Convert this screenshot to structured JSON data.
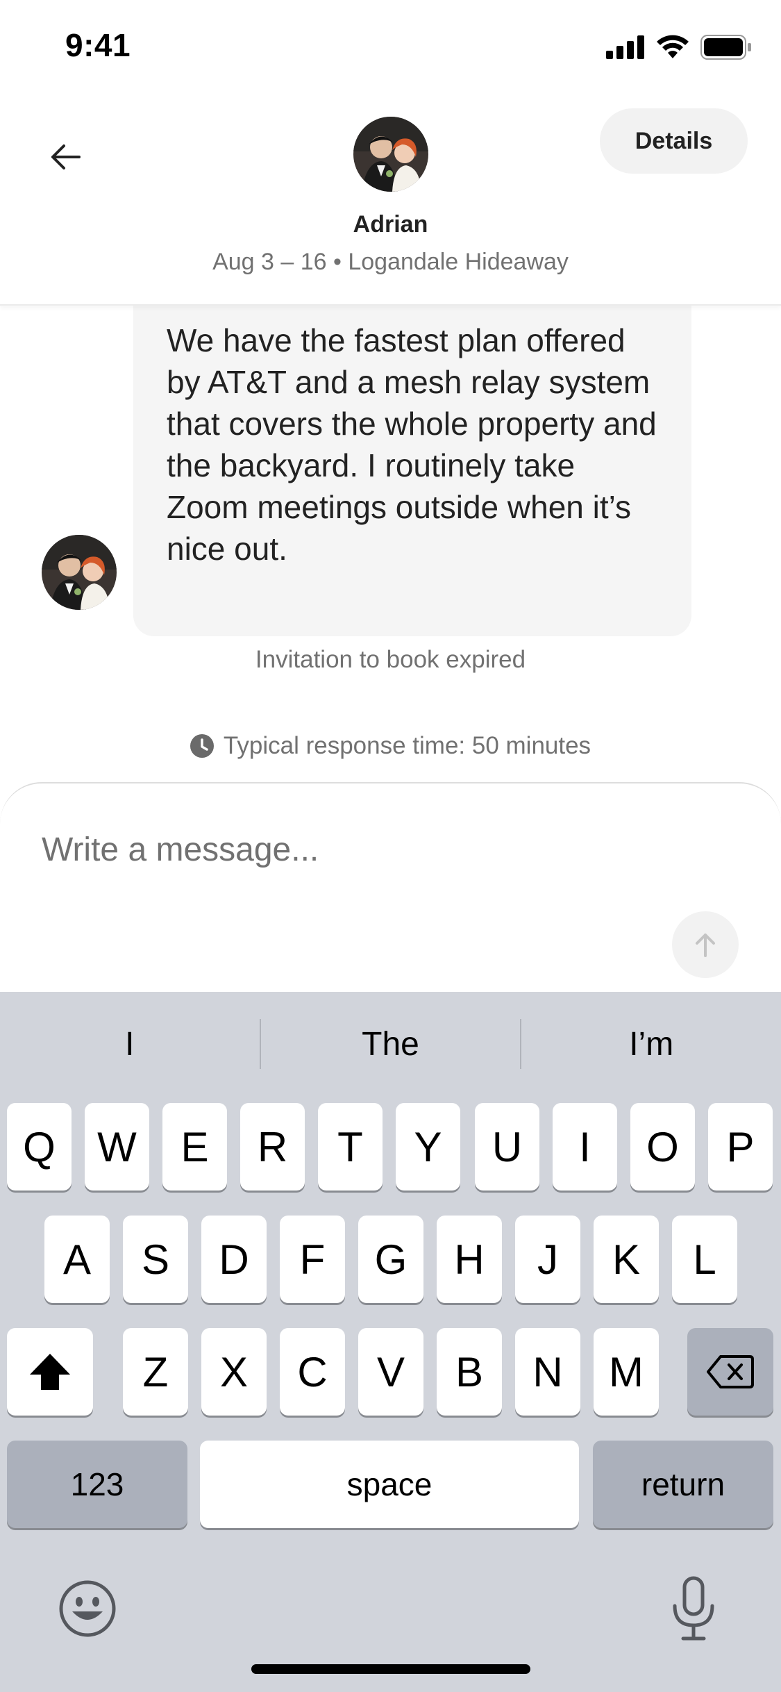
{
  "status_bar": {
    "time": "9:41",
    "icons": [
      "cellular-signal-icon",
      "wifi-icon",
      "battery-icon"
    ]
  },
  "header": {
    "back_icon": "arrow-left-icon",
    "host_name": "Adrian",
    "trip_info": "Aug 3 – 16 • Logandale Hideaway",
    "details_label": "Details"
  },
  "conversation": {
    "message_text": "We have the fastest plan offered by AT&T and a mesh relay system that covers the whole property and the backyard. I routinely take Zoom meetings outside when it’s nice out.",
    "system_note": "Invitation to book expired",
    "response_time": "Typical response time: 50 minutes"
  },
  "composer": {
    "placeholder": "Write a message...",
    "value": "",
    "send_icon": "arrow-up-icon"
  },
  "keyboard": {
    "suggestions": [
      "I",
      "The",
      "I’m"
    ],
    "row1": [
      "Q",
      "W",
      "E",
      "R",
      "T",
      "Y",
      "U",
      "I",
      "O",
      "P"
    ],
    "row2": [
      "A",
      "S",
      "D",
      "F",
      "G",
      "H",
      "J",
      "K",
      "L"
    ],
    "row3": [
      "Z",
      "X",
      "C",
      "V",
      "B",
      "N",
      "M"
    ],
    "numbers_label": "123",
    "space_label": "space",
    "return_label": "return"
  },
  "colors": {
    "text": "#222222",
    "secondary_text": "#717171",
    "bubble": "#f5f5f5",
    "keyboard_bg": "#d1d4db",
    "key_dark": "#abb0bb"
  }
}
